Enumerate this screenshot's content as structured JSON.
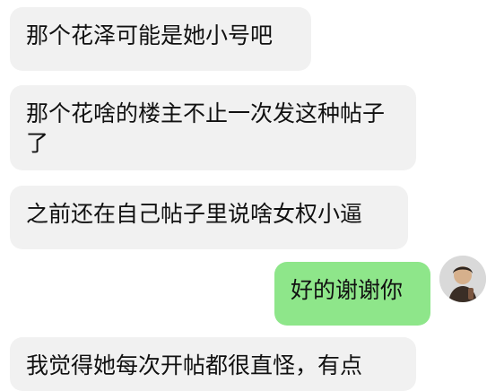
{
  "chat": {
    "messages": [
      {
        "side": "left",
        "text": "那个花泽可能是她小号吧"
      },
      {
        "side": "left",
        "text": "那个花啥的楼主不止一次发这种帖子了"
      },
      {
        "side": "left",
        "text": "之前还在自己帖子里说啥女权小逼"
      },
      {
        "side": "right",
        "text": "好的谢谢你"
      },
      {
        "side": "left",
        "text": "我觉得她每次开帖都很直怪，有点"
      }
    ],
    "colors": {
      "left_bubble": "#f1f1f1",
      "right_bubble": "#8ee68a",
      "text": "#111111"
    },
    "avatar_icon": "user-avatar-icon"
  }
}
